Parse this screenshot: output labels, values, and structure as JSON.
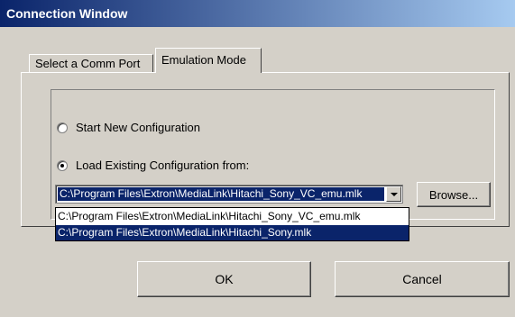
{
  "window": {
    "title": "Connection Window"
  },
  "tabs": [
    {
      "label": "Select a Comm Port"
    },
    {
      "label": "Emulation Mode"
    }
  ],
  "options": {
    "start_new": {
      "label": "Start New Configuration",
      "checked": false
    },
    "load_existing": {
      "label": "Load Existing Configuration from:",
      "checked": true
    }
  },
  "config_select": {
    "value": "C:\\Program Files\\Extron\\MediaLink\\Hitachi_Sony_VC_emu.mlk",
    "options": [
      "C:\\Program Files\\Extron\\MediaLink\\Hitachi_Sony_VC_emu.mlk",
      "C:\\Program Files\\Extron\\MediaLink\\Hitachi_Sony.mlk"
    ],
    "highlighted_index": 1
  },
  "buttons": {
    "browse": "Browse...",
    "ok": "OK",
    "cancel": "Cancel"
  },
  "colors": {
    "title_start": "#0a246a",
    "title_end": "#a6caf0",
    "face": "#d4d0c8",
    "highlight": "#0a246a"
  }
}
